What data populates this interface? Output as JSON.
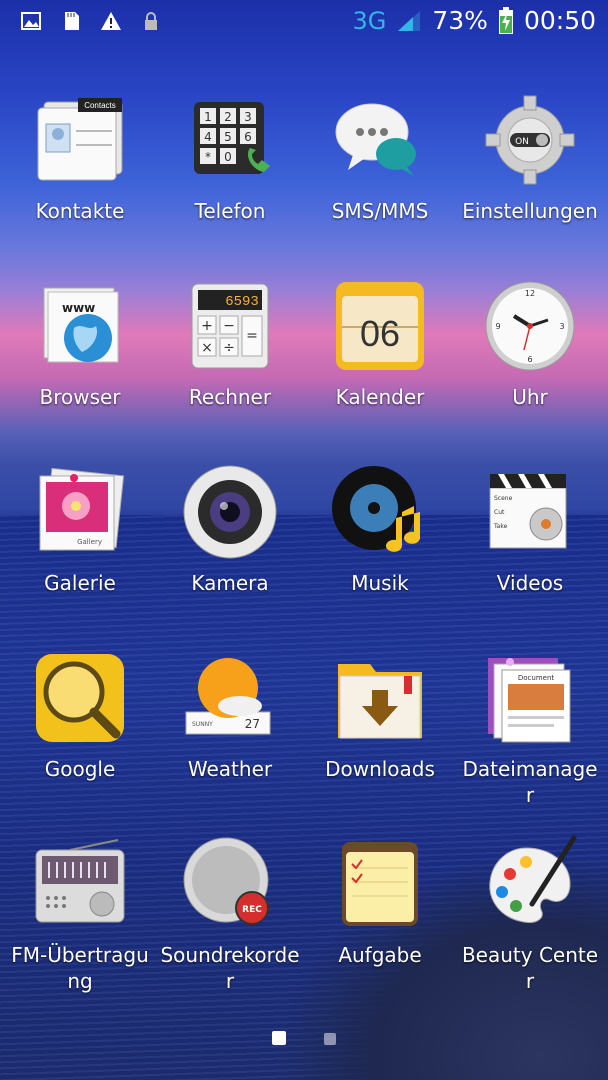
{
  "status": {
    "network": "3G",
    "battery": "73%",
    "time": "00:50"
  },
  "apps": [
    {
      "label": "Kontakte",
      "icon": "contacts-icon",
      "badge": "Contacts"
    },
    {
      "label": "Telefon",
      "icon": "phone-dialer-icon"
    },
    {
      "label": "SMS/MMS",
      "icon": "messaging-icon"
    },
    {
      "label": "Einstellungen",
      "icon": "settings-gear-icon",
      "badge": "ON"
    },
    {
      "label": "Browser",
      "icon": "globe-browser-icon",
      "badge": "www"
    },
    {
      "label": "Rechner",
      "icon": "calculator-icon",
      "badge": "6593"
    },
    {
      "label": "Kalender",
      "icon": "calendar-icon",
      "badge": "06"
    },
    {
      "label": "Uhr",
      "icon": "clock-icon"
    },
    {
      "label": "Galerie",
      "icon": "gallery-icon",
      "badge": "Gallery"
    },
    {
      "label": "Kamera",
      "icon": "camera-lens-icon"
    },
    {
      "label": "Musik",
      "icon": "music-disc-icon"
    },
    {
      "label": "Videos",
      "icon": "clapperboard-icon"
    },
    {
      "label": "Google",
      "icon": "search-magnifier-icon"
    },
    {
      "label": "Weather",
      "icon": "weather-sun-icon",
      "badge": "27"
    },
    {
      "label": "Downloads",
      "icon": "download-folder-icon"
    },
    {
      "label": "Dateimanager",
      "icon": "file-manager-icon",
      "badge": "Document"
    },
    {
      "label": "FM-Übertragung",
      "icon": "fm-radio-icon"
    },
    {
      "label": "Soundrekorder",
      "icon": "sound-recorder-icon",
      "badge": "REC"
    },
    {
      "label": "Aufgabe",
      "icon": "notepad-task-icon"
    },
    {
      "label": "Beauty Center",
      "icon": "paint-palette-icon"
    }
  ],
  "pages": {
    "count": 2,
    "current": 1
  }
}
